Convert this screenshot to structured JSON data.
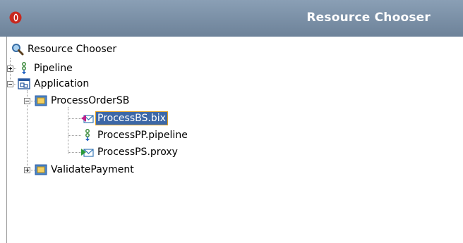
{
  "window": {
    "title": "Resource Chooser",
    "logo_icon": "oracle-logo-icon",
    "colors": {
      "titlebar": "#7b90a6",
      "selection": "#3c67a6",
      "selection_outline": "#e0a020"
    }
  },
  "tree": {
    "root": {
      "label": "Resource Chooser",
      "icon": "search-icon"
    },
    "nodes": [
      {
        "label": "Pipeline",
        "icon": "pipeline-icon",
        "expanded": false
      },
      {
        "label": "Application",
        "icon": "application-icon",
        "expanded": true
      },
      {
        "label": "ProcessOrderSB",
        "icon": "folder-icon",
        "expanded": true
      },
      {
        "label": "ProcessBS.bix",
        "icon": "business-service-icon",
        "selected": true
      },
      {
        "label": "ProcessPP.pipeline",
        "icon": "pipeline-icon"
      },
      {
        "label": "ProcessPS.proxy",
        "icon": "proxy-service-icon"
      },
      {
        "label": "ValidatePayment",
        "icon": "folder-icon",
        "expanded": false
      }
    ]
  }
}
